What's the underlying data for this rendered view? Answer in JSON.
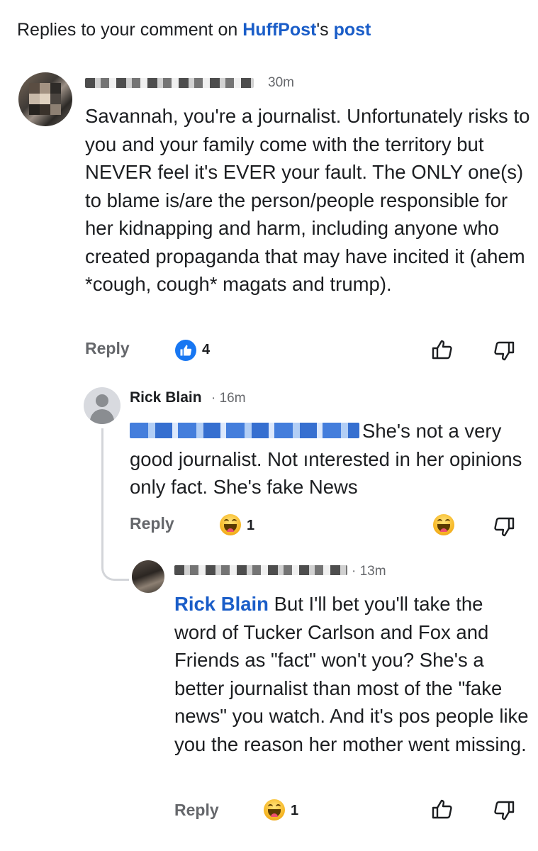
{
  "header": {
    "prefix": "Replies to your comment on ",
    "page_name": "HuffPost",
    "possessive": "'s ",
    "post_link": "post"
  },
  "comments": [
    {
      "author_redacted": true,
      "time": "30m",
      "text": "Savannah, you're a journalist. Unfortunately risks to you and your family come with the territory but NEVER feel it's EVER your fault. The ONLY one(s) to blame is/are the person/people responsible for her kidnapping and harm, including anyone who created propaganda that may have incited it (ahem *cough, cough* magats and trump).",
      "reply_label": "Reply",
      "reaction": {
        "icon": "like-icon",
        "count": "4"
      }
    },
    {
      "author": "Rick Blain",
      "separator": "·",
      "time": "16m",
      "text": "She's not a very good journalist. Not ınterested in her opinions only fact. She's fake News",
      "reply_label": "Reply",
      "reaction": {
        "icon": "haha-icon",
        "count": "1"
      }
    },
    {
      "author_redacted": true,
      "separator": "·",
      "time": "13m",
      "mention": "Rick Blain",
      "text": " But I'll bet you'll take the word of Tucker Carlson and Fox and Friends as \"fact\" won't you? She's a better journalist than most of the \"fake news\" you watch. And it's pos people like you the reason her mother went missing.",
      "reply_label": "Reply",
      "reaction": {
        "icon": "haha-icon",
        "count": "1"
      }
    }
  ],
  "colors": {
    "link_blue": "#1a5dc8",
    "facebook_blue": "#1877f2",
    "muted_gray": "#65676b",
    "haha_yellow": "#f7b928"
  }
}
